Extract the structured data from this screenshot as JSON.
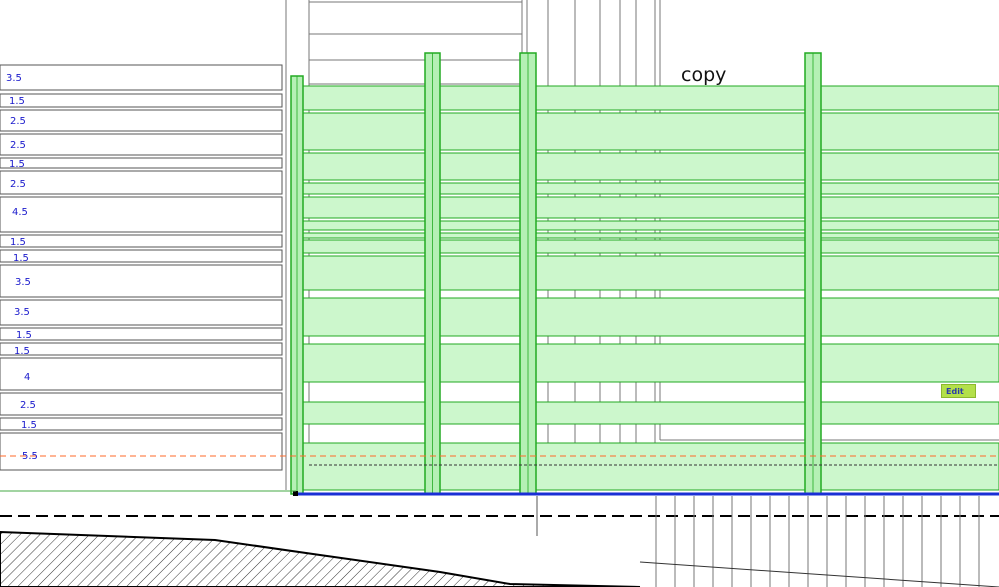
{
  "copy_label": "copy",
  "edit_button": {
    "label": "Edit"
  },
  "dimensions": [
    "3.5",
    "1.5",
    "2.5",
    "2.5",
    "1.5",
    "2.5",
    "4.5",
    "1.5",
    "1.5",
    "3.5",
    "3.5",
    "1.5",
    "1.5",
    "4",
    "2.5",
    "1.5",
    "5.5"
  ],
  "colors": {
    "fence_fill": "#ccf7cc",
    "fence_stroke": "#22aa22",
    "ground_line": "#1a2fd6",
    "dimension_text": "#1a1acc",
    "cut_line": "#ff6a2a"
  }
}
